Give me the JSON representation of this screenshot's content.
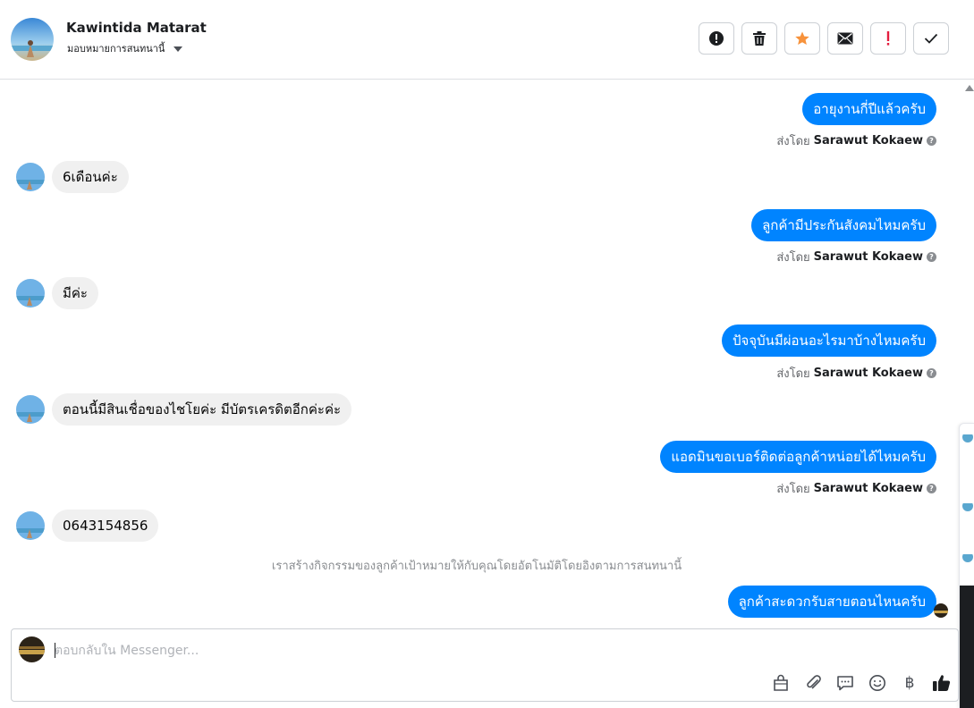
{
  "header": {
    "contact_name": "Kawintida Matarat",
    "assign_label": "มอบหมายการสนทนานี้",
    "actions": [
      {
        "icon": "alert-circle-icon",
        "color": "#1c1e21"
      },
      {
        "icon": "trash-icon",
        "color": "#1c1e21"
      },
      {
        "icon": "star-icon",
        "color": "#f7923b"
      },
      {
        "icon": "envelope-icon",
        "color": "#1c1e21"
      },
      {
        "icon": "exclamation-icon",
        "color": "#e41e3f"
      },
      {
        "icon": "check-icon",
        "color": "#1c1e21"
      }
    ]
  },
  "conversation": {
    "sent_by_prefix": "ส่งโดย",
    "agent_name": "Sarawut Kokaew",
    "messages": [
      {
        "from": "page",
        "text": "อายุงานกี่ปีแล้วครับ"
      },
      {
        "from": "customer",
        "text": "6เดือนค่ะ"
      },
      {
        "from": "page",
        "text": "ลูกค้ามีประกันสังคมไหมครับ"
      },
      {
        "from": "customer",
        "text": "มีค่ะ"
      },
      {
        "from": "page",
        "text": "ปัจจุบันมีผ่อนอะไรมาบ้างไหมครับ"
      },
      {
        "from": "customer",
        "text": "ตอนนี้มีสินเชื่อของไชโยค่ะ มีบัตรเครดิตอีกค่ะค่ะ"
      },
      {
        "from": "page",
        "text": "แอดมินขอเบอร์ติดต่อลูกค้าหน่อยได้ไหมครับ"
      },
      {
        "from": "customer",
        "text": "0643154856"
      },
      {
        "from": "page",
        "text": "ลูกค้าสะดวกรับสายตอนไหนครับ"
      }
    ],
    "system_note": "เราสร้างกิจกรรมของลูกค้าเป้าหมายให้กับคุณโดยอัตโนมัติโดยอิงตามการสนทนานี้"
  },
  "composer": {
    "placeholder": "ตอบกลับใน Messenger...",
    "value": "",
    "currency_symbol": "฿",
    "like_color": "#1c1e21"
  },
  "colors": {
    "outgoing_bubble": "#0084ff",
    "incoming_bubble": "#f0f0f0"
  }
}
